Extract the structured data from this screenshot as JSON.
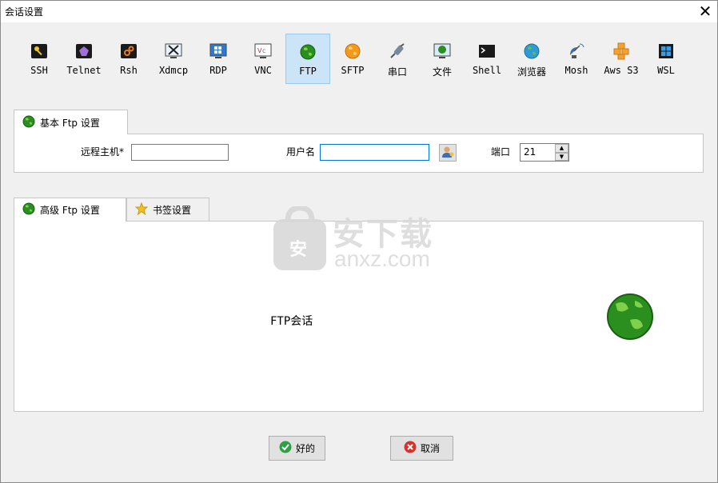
{
  "window": {
    "title": "会话设置",
    "close_glyph": "✕"
  },
  "toolbar": {
    "items": [
      {
        "label": "SSH",
        "icon": "key-icon"
      },
      {
        "label": "Telnet",
        "icon": "telnet-icon"
      },
      {
        "label": "Rsh",
        "icon": "rsh-icon"
      },
      {
        "label": "Xdmcp",
        "icon": "xdmcp-icon"
      },
      {
        "label": "RDP",
        "icon": "rdp-icon"
      },
      {
        "label": "VNC",
        "icon": "vnc-icon"
      },
      {
        "label": "FTP",
        "icon": "globe-green-icon",
        "active": true
      },
      {
        "label": "SFTP",
        "icon": "globe-orange-icon"
      },
      {
        "label": "串口",
        "icon": "serial-plug-icon"
      },
      {
        "label": "文件",
        "icon": "file-monitor-icon"
      },
      {
        "label": "Shell",
        "icon": "terminal-icon"
      },
      {
        "label": "浏览器",
        "icon": "browser-globe-icon"
      },
      {
        "label": "Mosh",
        "icon": "satellite-dish-icon"
      },
      {
        "label": "Aws S3",
        "icon": "aws-cubes-icon"
      },
      {
        "label": "WSL",
        "icon": "windows-icon"
      }
    ]
  },
  "basic": {
    "tab_label": "基本 Ftp 设置",
    "remote_host_label": "远程主机*",
    "remote_host_value": "",
    "username_label": "用户名",
    "username_value": "",
    "port_label": "端口",
    "port_value": "21"
  },
  "advanced": {
    "tab_advanced": "高级 Ftp 设置",
    "tab_bookmark": "书签设置",
    "session_caption": "FTP会话"
  },
  "watermark": {
    "cn": "安下载",
    "en": "anxz.com",
    "badge": "安"
  },
  "buttons": {
    "ok": "好的",
    "cancel": "取消"
  },
  "colors": {
    "accent": "#0078d7",
    "active_bg": "#cce4f7",
    "ftp_green": "#1e8c1e",
    "ok_green": "#2ea043",
    "cancel_red": "#d9302c"
  }
}
